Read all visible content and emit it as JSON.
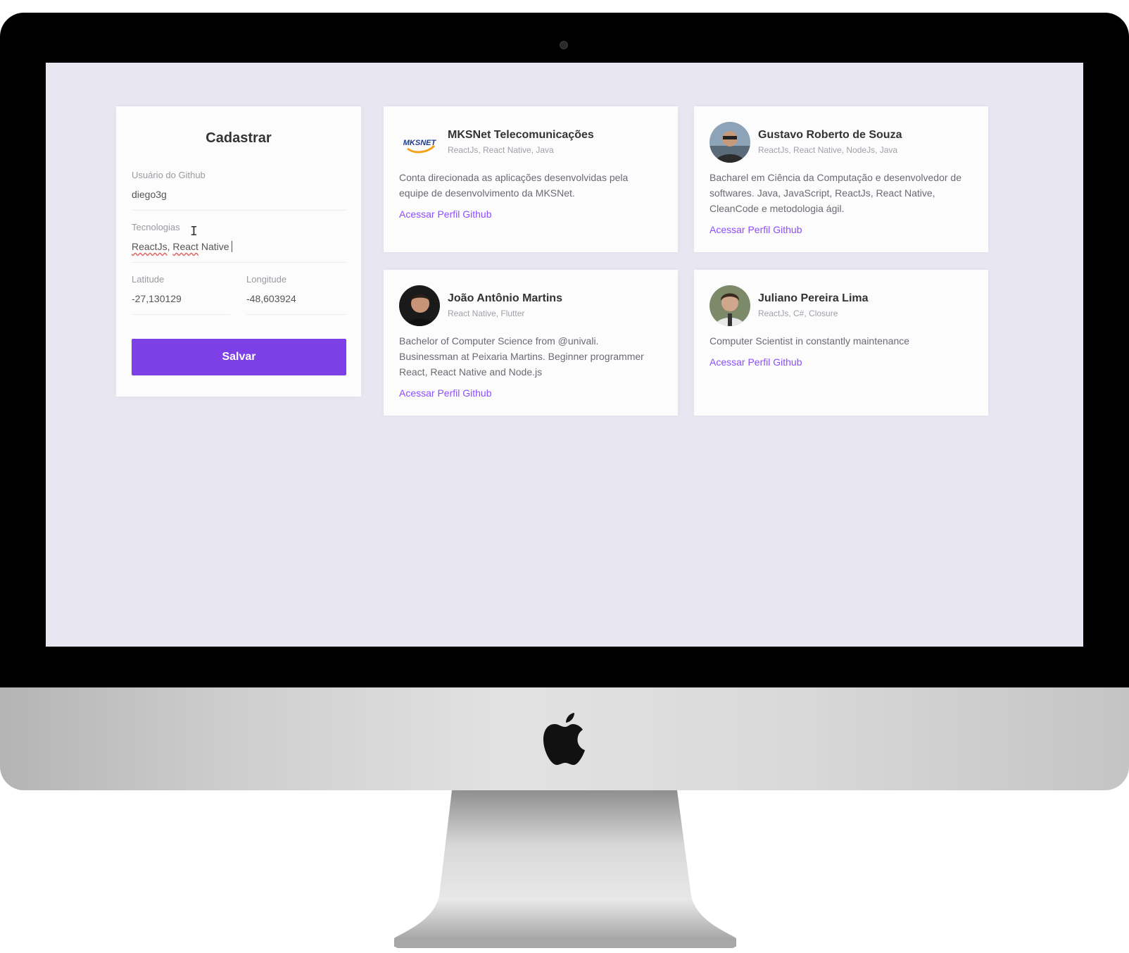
{
  "form": {
    "title": "Cadastrar",
    "github_user_label": "Usuário do Github",
    "github_user_value": "diego3g",
    "techs_label": "Tecnologias",
    "techs_value_part1": "ReactJs",
    "techs_value_sep1": ", ",
    "techs_value_part2": "React",
    "techs_value_part3": " Native",
    "latitude_label": "Latitude",
    "latitude_value": "-27,130129",
    "longitude_label": "Longitude",
    "longitude_value": "-48,603924",
    "save_label": "Salvar"
  },
  "devs": [
    {
      "name": "MKSNet Telecomunicações",
      "techs": "ReactJs, React Native, Java",
      "bio": "Conta direcionada as aplicações desenvolvidas pela equipe de desenvolvimento da MKSNet.",
      "link": "Acessar Perfil Github",
      "avatar": "mksnet-logo-icon",
      "logo_text": "MKSNET"
    },
    {
      "name": "Gustavo Roberto de Souza",
      "techs": "ReactJs, React Native, NodeJs, Java",
      "bio": "Bacharel em Ciência da Computação e desenvolvedor de softwares. Java, JavaScript, ReactJs, React Native, CleanCode e metodologia ágil.",
      "link": "Acessar Perfil Github",
      "avatar": "user-photo-icon"
    },
    {
      "name": "João Antônio Martins",
      "techs": "React Native, Flutter",
      "bio": "Bachelor of Computer Science from @univali. Businessman at Peixaria Martins. Beginner programmer React, React Native and Node.js",
      "link": "Acessar Perfil Github",
      "avatar": "user-photo-icon"
    },
    {
      "name": "Juliano Pereira Lima",
      "techs": "ReactJs, C#, Closure",
      "bio": "Computer Scientist in constantly maintenance",
      "link": "Acessar Perfil Github",
      "avatar": "user-photo-icon"
    }
  ],
  "colors": {
    "primary": "#7d40e7",
    "link": "#8e4dff",
    "screen_bg": "#e7e6f1",
    "card_bg": "#fcfcfd"
  }
}
